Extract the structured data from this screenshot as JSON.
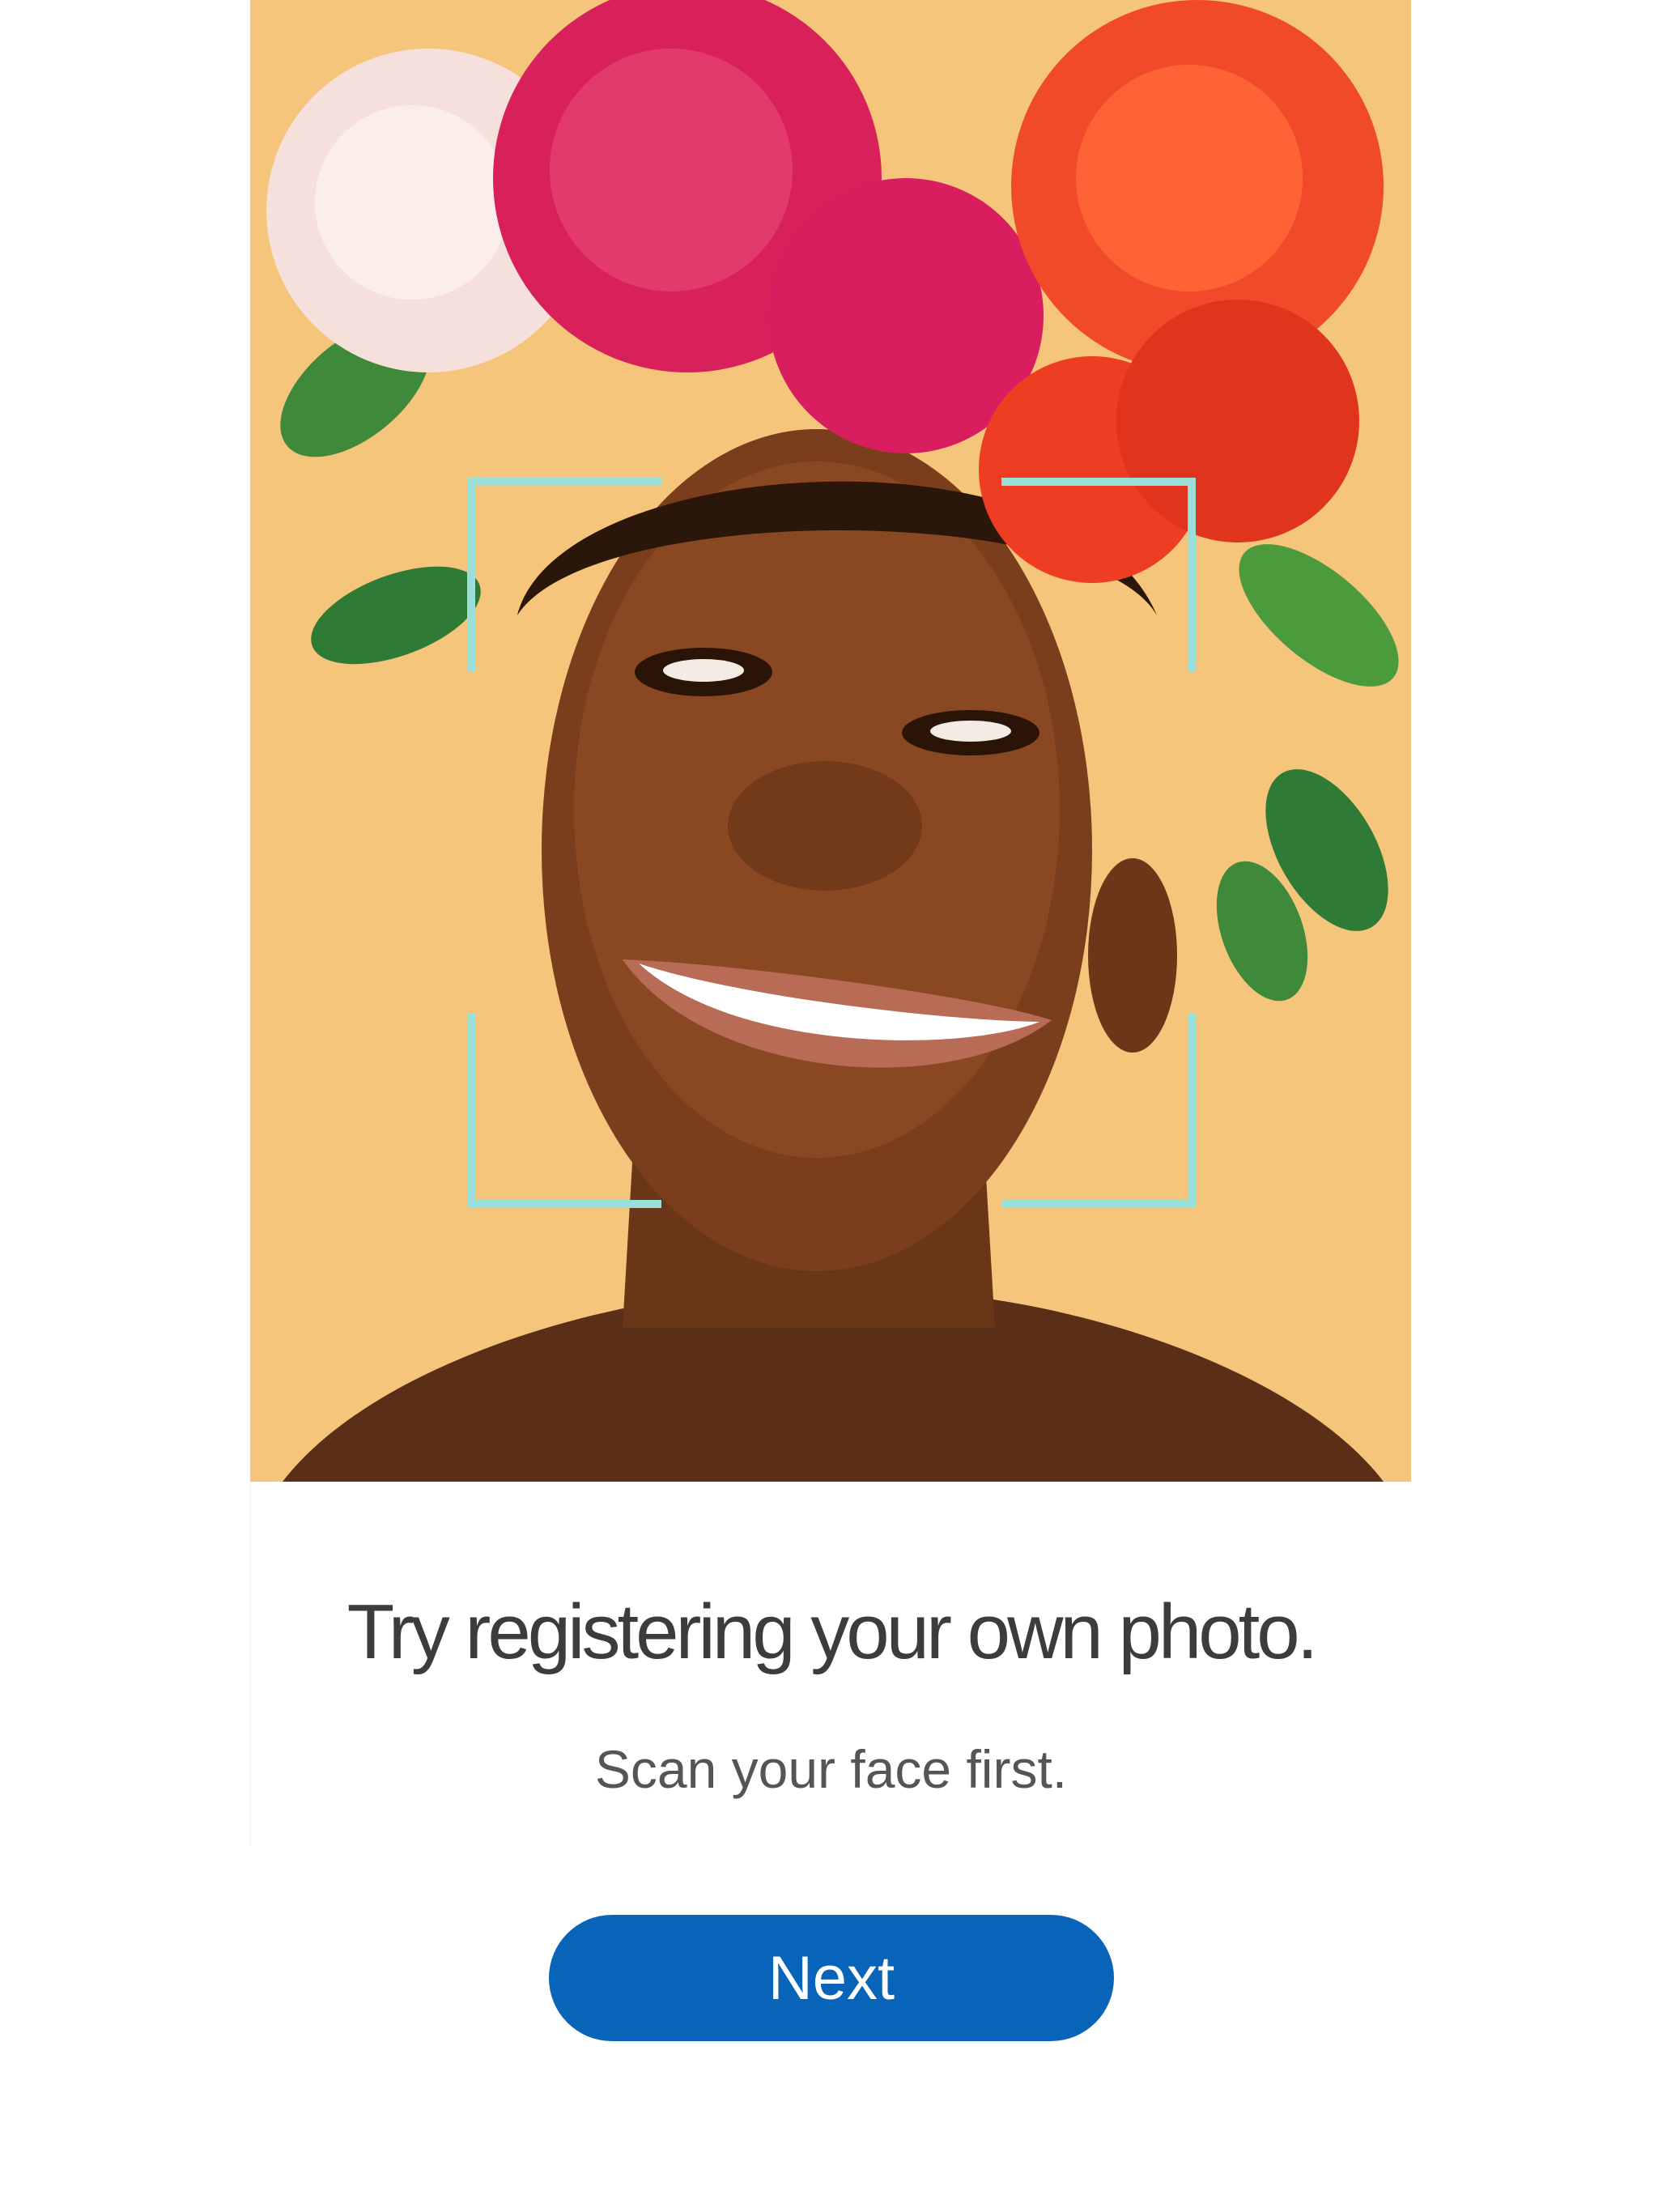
{
  "intro": {
    "title": "Try registering your own photo.",
    "subtitle": "Scan your face first.",
    "next_label": "Next"
  },
  "photo": {
    "description_icon": "portrait-photo",
    "scan_frame_color": "#9bdfdb"
  },
  "colors": {
    "accent": "#0764b8",
    "photo_background": "#f4c57a"
  }
}
